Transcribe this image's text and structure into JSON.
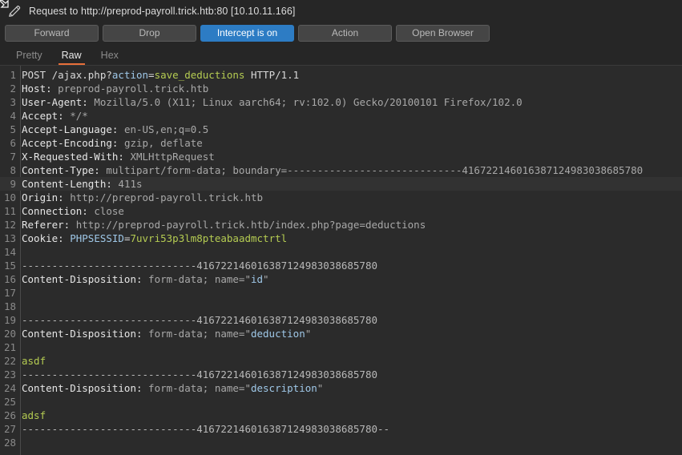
{
  "window": {
    "icon": "pencil-icon",
    "title": "Request to http://preprod-payroll.trick.htb:80  [10.10.11.166]"
  },
  "toolbar": {
    "forward_label": "Forward",
    "drop_label": "Drop",
    "intercept_label": "Intercept is on",
    "action_label": "Action",
    "open_browser_label": "Open Browser",
    "accent_color": "#2d7cc4"
  },
  "tabs": {
    "active": "Raw",
    "accent_color": "#e8703a",
    "items": [
      {
        "label": "Pretty"
      },
      {
        "label": "Raw"
      },
      {
        "label": "Hex"
      }
    ]
  },
  "editor": {
    "cursor_line": 9,
    "boundary": "-----------------------------416722146016387124983038685780",
    "lines": [
      {
        "n": "1",
        "tokens": [
          {
            "t": "POST /ajax.php?",
            "c": "plain"
          },
          {
            "t": "action",
            "c": "param"
          },
          {
            "t": "=",
            "c": "plain"
          },
          {
            "t": "save_deductions",
            "c": "pval"
          },
          {
            "t": " HTTP/1.1",
            "c": "plain"
          }
        ]
      },
      {
        "n": "2",
        "tokens": [
          {
            "t": "Host:",
            "c": "key"
          },
          {
            "t": " preprod-payroll.trick.htb",
            "c": "val"
          }
        ]
      },
      {
        "n": "3",
        "tokens": [
          {
            "t": "User-Agent:",
            "c": "key"
          },
          {
            "t": " Mozilla/5.0 (X11; Linux aarch64; rv:102.0) Gecko/20100101 Firefox/102.0",
            "c": "val"
          }
        ]
      },
      {
        "n": "4",
        "tokens": [
          {
            "t": "Accept:",
            "c": "key"
          },
          {
            "t": " */*",
            "c": "val"
          }
        ]
      },
      {
        "n": "5",
        "tokens": [
          {
            "t": "Accept-Language:",
            "c": "key"
          },
          {
            "t": " en-US,en;q=0.5",
            "c": "val"
          }
        ]
      },
      {
        "n": "6",
        "tokens": [
          {
            "t": "Accept-Encoding:",
            "c": "key"
          },
          {
            "t": " gzip, deflate",
            "c": "val"
          }
        ]
      },
      {
        "n": "7",
        "tokens": [
          {
            "t": "X-Requested-With:",
            "c": "key"
          },
          {
            "t": " XMLHttpRequest",
            "c": "val"
          }
        ]
      },
      {
        "n": "8",
        "tokens": [
          {
            "t": "Content-Type:",
            "c": "key"
          },
          {
            "t": " multipart/form-data; boundary=",
            "c": "val"
          },
          {
            "t": "-----------------------------416722146016387124983038685780",
            "c": "val"
          }
        ]
      },
      {
        "n": "9",
        "tokens": [
          {
            "t": "Content-Length:",
            "c": "key"
          },
          {
            "t": " 411s",
            "c": "val"
          }
        ]
      },
      {
        "n": "10",
        "tokens": [
          {
            "t": "Origin:",
            "c": "key"
          },
          {
            "t": " http://preprod-payroll.trick.htb",
            "c": "val"
          }
        ]
      },
      {
        "n": "11",
        "tokens": [
          {
            "t": "Connection:",
            "c": "key"
          },
          {
            "t": " close",
            "c": "val"
          }
        ]
      },
      {
        "n": "12",
        "tokens": [
          {
            "t": "Referer:",
            "c": "key"
          },
          {
            "t": " http://preprod-payroll.trick.htb/index.php?page=deductions",
            "c": "val"
          }
        ]
      },
      {
        "n": "13",
        "tokens": [
          {
            "t": "Cookie:",
            "c": "key"
          },
          {
            "t": " ",
            "c": "val"
          },
          {
            "t": "PHPSESSID",
            "c": "param"
          },
          {
            "t": "=",
            "c": "plain"
          },
          {
            "t": "7uvri53p3lm8pteabaadmctrtl",
            "c": "pval"
          }
        ]
      },
      {
        "n": "14",
        "tokens": []
      },
      {
        "n": "15",
        "tokens": [
          {
            "t": "-----------------------------416722146016387124983038685780",
            "c": "dash"
          }
        ]
      },
      {
        "n": "16",
        "tokens": [
          {
            "t": "Content-Disposition:",
            "c": "key"
          },
          {
            "t": " form-data; name=",
            "c": "val"
          },
          {
            "t": "\"",
            "c": "val"
          },
          {
            "t": "id",
            "c": "param"
          },
          {
            "t": "\"",
            "c": "val"
          }
        ]
      },
      {
        "n": "17",
        "tokens": []
      },
      {
        "n": "18",
        "tokens": []
      },
      {
        "n": "19",
        "tokens": [
          {
            "t": "-----------------------------416722146016387124983038685780",
            "c": "dash"
          }
        ]
      },
      {
        "n": "20",
        "tokens": [
          {
            "t": "Content-Disposition:",
            "c": "key"
          },
          {
            "t": " form-data; name=",
            "c": "val"
          },
          {
            "t": "\"",
            "c": "val"
          },
          {
            "t": "deduction",
            "c": "param"
          },
          {
            "t": "\"",
            "c": "val"
          }
        ]
      },
      {
        "n": "21",
        "tokens": []
      },
      {
        "n": "22",
        "tokens": [
          {
            "t": "asdf",
            "c": "pval"
          }
        ]
      },
      {
        "n": "23",
        "tokens": [
          {
            "t": "-----------------------------416722146016387124983038685780",
            "c": "dash"
          }
        ]
      },
      {
        "n": "24",
        "tokens": [
          {
            "t": "Content-Disposition:",
            "c": "key"
          },
          {
            "t": " form-data; name=",
            "c": "val"
          },
          {
            "t": "\"",
            "c": "val"
          },
          {
            "t": "description",
            "c": "param"
          },
          {
            "t": "\"",
            "c": "val"
          }
        ]
      },
      {
        "n": "25",
        "tokens": []
      },
      {
        "n": "26",
        "tokens": [
          {
            "t": "adsf",
            "c": "pval"
          }
        ]
      },
      {
        "n": "27",
        "tokens": [
          {
            "t": "-----------------------------416722146016387124983038685780--",
            "c": "dash"
          }
        ]
      },
      {
        "n": "28",
        "tokens": []
      }
    ]
  }
}
